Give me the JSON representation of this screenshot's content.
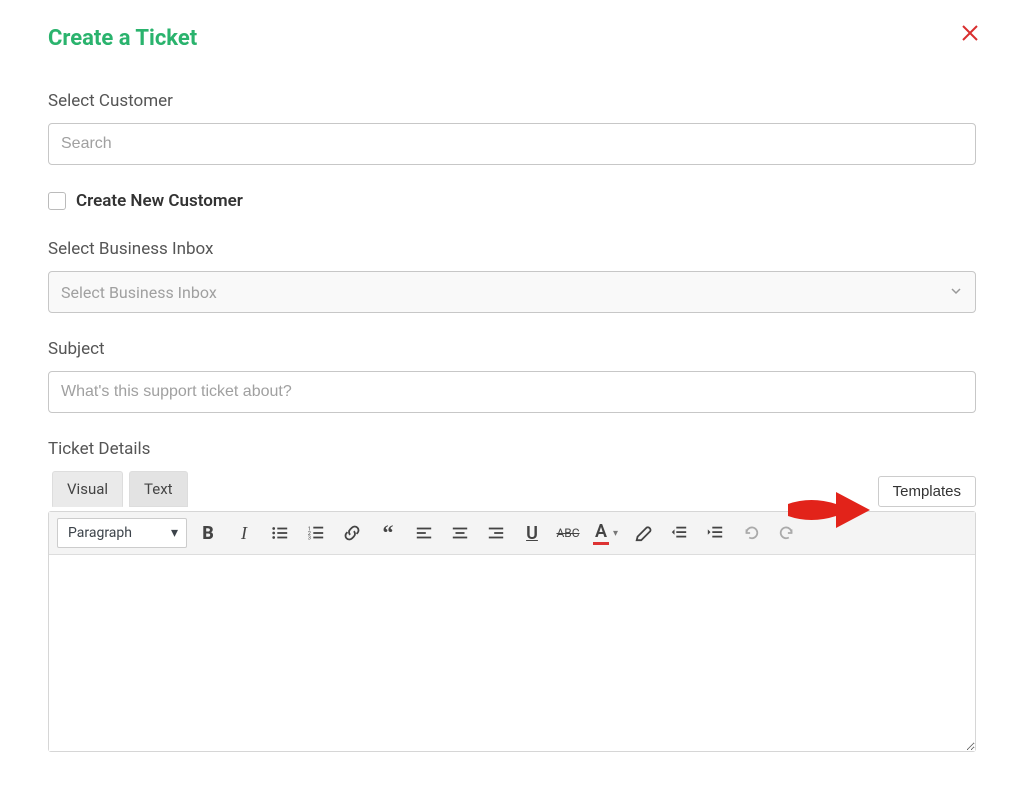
{
  "title": "Create a Ticket",
  "customer": {
    "label": "Select Customer",
    "placeholder": "Search"
  },
  "create_new_customer_label": "Create New Customer",
  "inbox": {
    "label": "Select Business Inbox",
    "placeholder": "Select Business Inbox"
  },
  "subject": {
    "label": "Subject",
    "placeholder": "What's this support ticket about?"
  },
  "details": {
    "label": "Ticket Details",
    "tabs": {
      "visual": "Visual",
      "text": "Text"
    },
    "templates_button": "Templates",
    "format_dropdown": "Paragraph"
  }
}
